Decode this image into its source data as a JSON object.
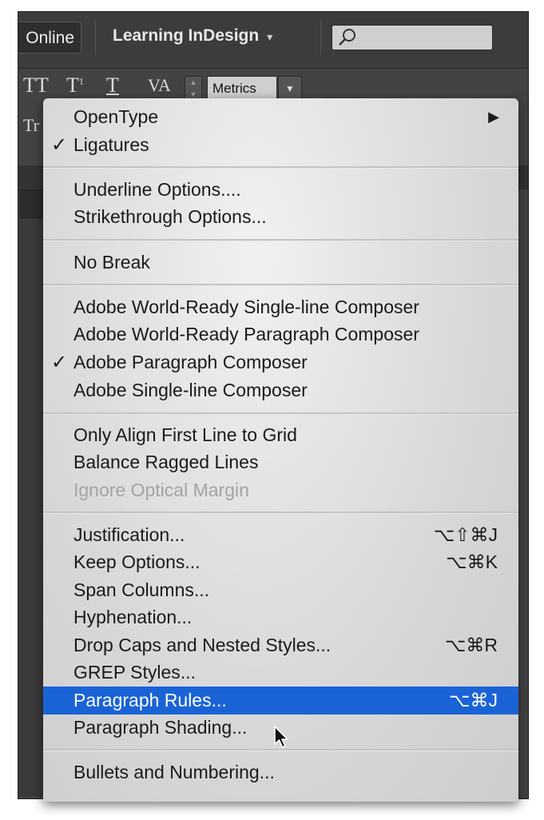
{
  "app": {
    "online_label": "Online",
    "workspace_label": "Learning InDesign",
    "workspace_caret": "▾",
    "search": {
      "placeholder": ""
    }
  },
  "toolbar": {
    "tt_label": "TT",
    "tsup_label": "T",
    "tsup_sup": "1",
    "tunder_label": "T",
    "va_label": "VA",
    "tr_label": "Tr",
    "kerning_value": "Metrics"
  },
  "menu": {
    "items": [
      {
        "label": "OpenType",
        "submenu_arrow": "▶"
      },
      {
        "label": "Ligatures",
        "check": "✓"
      },
      {
        "label": "Underline Options...."
      },
      {
        "label": "Strikethrough Options..."
      },
      {
        "label": "No Break"
      },
      {
        "label": "Adobe World-Ready Single-line Composer"
      },
      {
        "label": "Adobe World-Ready Paragraph Composer"
      },
      {
        "label": "Adobe Paragraph Composer",
        "check": "✓"
      },
      {
        "label": "Adobe Single-line Composer"
      },
      {
        "label": "Only Align First Line to Grid"
      },
      {
        "label": "Balance Ragged Lines"
      },
      {
        "label": "Ignore Optical Margin",
        "disabled": true
      },
      {
        "label": "Justification...",
        "shortcut": "⌥⇧⌘J"
      },
      {
        "label": "Keep Options...",
        "shortcut": "⌥⌘K"
      },
      {
        "label": "Span Columns..."
      },
      {
        "label": "Hyphenation..."
      },
      {
        "label": "Drop Caps and Nested Styles...",
        "shortcut": "⌥⌘R"
      },
      {
        "label": "GREP Styles..."
      },
      {
        "label": "Paragraph Rules...",
        "shortcut": "⌥⌘J",
        "highlighted": true
      },
      {
        "label": "Paragraph Shading..."
      },
      {
        "label": "Bullets and Numbering..."
      }
    ]
  },
  "colors": {
    "highlight": "#1a63d6",
    "app_dark": "#434343",
    "menu_bg": "#e0e0e0"
  }
}
